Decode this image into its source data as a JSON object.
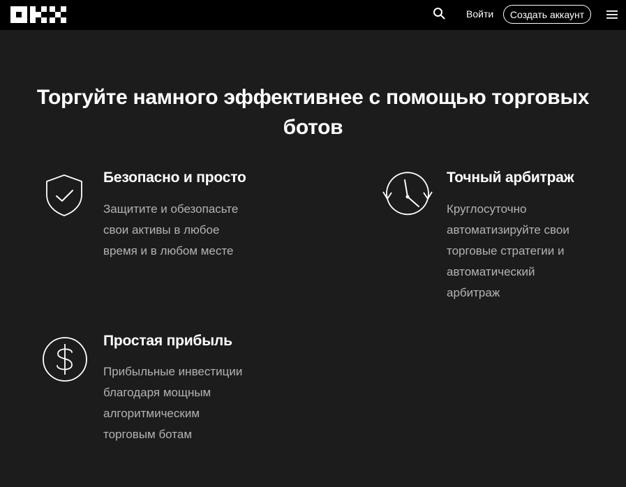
{
  "header": {
    "logo_text": "OKX",
    "search_icon": "search-icon",
    "login_label": "Войти",
    "signup_label": "Создать аккаунт",
    "menu_icon": "hamburger-menu-icon"
  },
  "main": {
    "title": "Торгуйте намного эффективнее с помощью торговых ботов",
    "features": [
      {
        "icon": "shield-check-icon",
        "title": "Безопасно и просто",
        "description": "Защитите и обезопасьте свои активы в любое время и в любом месте"
      },
      {
        "icon": "clock-icon",
        "title": "Точный арбитраж",
        "description": "Круглосуточно автоматизируйте свои торговые стратегии и автоматический арбитраж"
      },
      {
        "icon": "dollar-coin-icon",
        "title": "Простая прибыль",
        "description": "Прибыльные инвестиции благодаря мощным алгоритмическим торговым ботам"
      }
    ]
  },
  "colors": {
    "background": "#1c1c1c",
    "header_background": "#000000",
    "text_primary": "#ffffff",
    "text_secondary": "#b3b3b3"
  }
}
